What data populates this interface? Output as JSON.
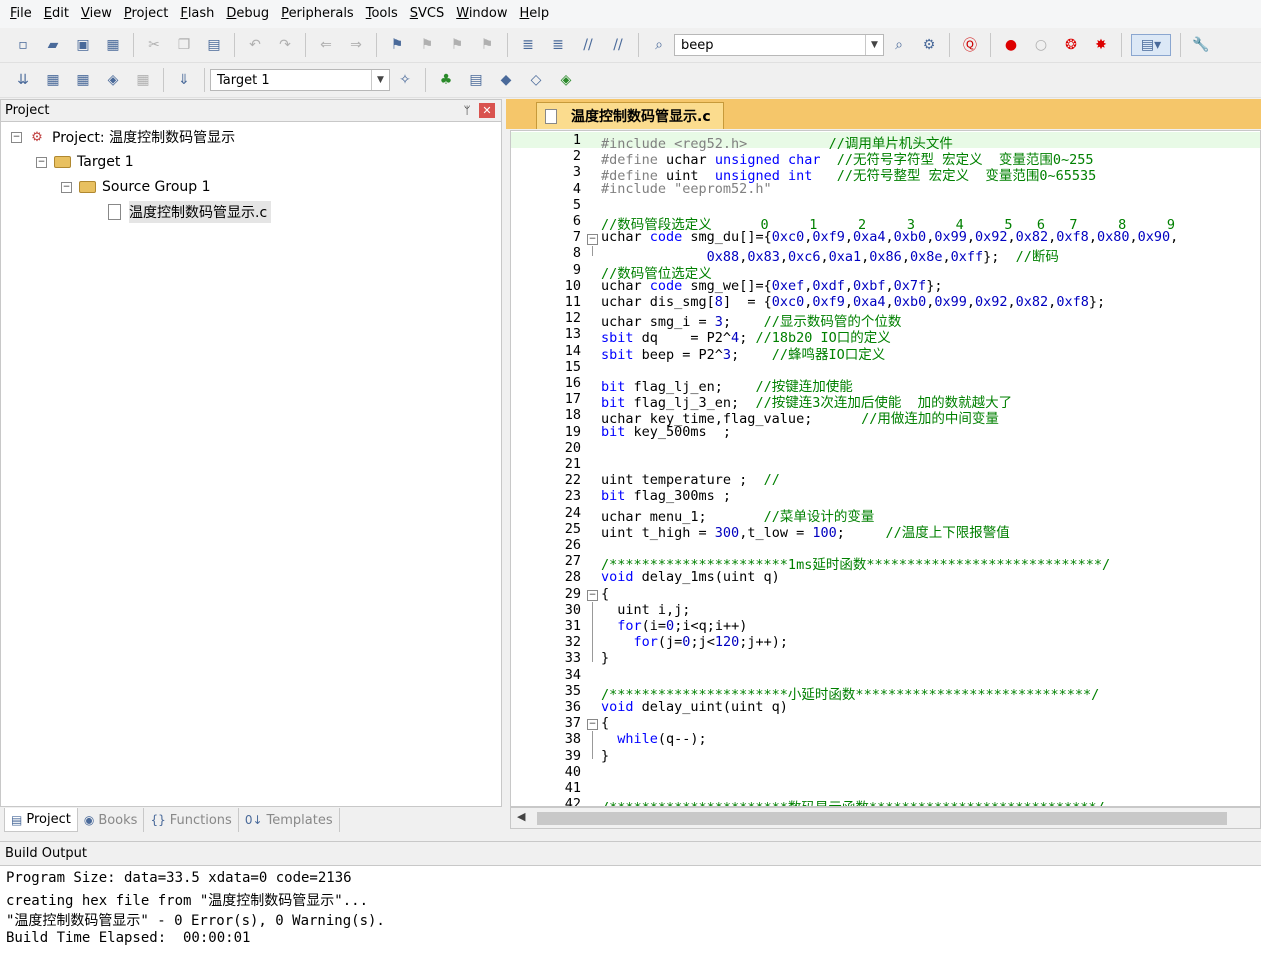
{
  "menu": [
    "File",
    "Edit",
    "View",
    "Project",
    "Flash",
    "Debug",
    "Peripherals",
    "Tools",
    "SVCS",
    "Window",
    "Help"
  ],
  "toolbar": {
    "find_combo_value": "beep",
    "target_combo_value": "Target 1"
  },
  "project_panel": {
    "title": "Project",
    "pin": "ᛘ",
    "close": "✕",
    "project_label": "Project: 温度控制数码管显示",
    "target_label": "Target 1",
    "group_label": "Source Group 1",
    "file_label": "温度控制数码管显示.c",
    "tabs": [
      {
        "icon": "▤",
        "label": "Project"
      },
      {
        "icon": "◉",
        "label": "Books"
      },
      {
        "icon": "{}",
        "label": "Functions"
      },
      {
        "icon": "0↓",
        "label": "Templates"
      }
    ]
  },
  "editor": {
    "tab_label": "温度控制数码管显示.c",
    "line_numbers": [
      "1",
      "2",
      "3",
      "4",
      "5",
      "6",
      "7",
      "8",
      "9",
      "10",
      "11",
      "12",
      "13",
      "14",
      "15",
      "16",
      "17",
      "18",
      "19",
      "20",
      "21",
      "22",
      "23",
      "24",
      "25",
      "26",
      "27",
      "28",
      "29",
      "30",
      "31",
      "32",
      "33",
      "34",
      "35",
      "36",
      "37",
      "38",
      "39",
      "40",
      "41",
      "42"
    ],
    "lines": [
      [
        [
          "pp",
          "#include <reg52.h>          "
        ],
        [
          "cm",
          "//调用单片机头文件"
        ]
      ],
      [
        [
          "pp",
          "#define "
        ],
        [
          "t",
          "uchar "
        ],
        [
          "kw",
          "unsigned char  "
        ],
        [
          "cm",
          "//无符号字符型 宏定义  变量范围0~255"
        ]
      ],
      [
        [
          "pp",
          "#define "
        ],
        [
          "t",
          "uint  "
        ],
        [
          "kw",
          "unsigned int   "
        ],
        [
          "cm",
          "//无符号整型 宏定义  变量范围0~65535"
        ]
      ],
      [
        [
          "pp",
          "#include \"eeprom52.h\""
        ]
      ],
      [
        [
          "t",
          ""
        ]
      ],
      [
        [
          "cm",
          "//数码管段选定义      0     1     2     3     4     5   6   7     8     9"
        ]
      ],
      [
        [
          "t",
          "uchar "
        ],
        [
          "kw",
          "code "
        ],
        [
          "t",
          "smg_du[]={"
        ],
        [
          "num",
          "0xc0"
        ],
        [
          "t",
          ","
        ],
        [
          "num",
          "0xf9"
        ],
        [
          "t",
          ","
        ],
        [
          "num",
          "0xa4"
        ],
        [
          "t",
          ","
        ],
        [
          "num",
          "0xb0"
        ],
        [
          "t",
          ","
        ],
        [
          "num",
          "0x99"
        ],
        [
          "t",
          ","
        ],
        [
          "num",
          "0x92"
        ],
        [
          "t",
          ","
        ],
        [
          "num",
          "0x82"
        ],
        [
          "t",
          ","
        ],
        [
          "num",
          "0xf8"
        ],
        [
          "t",
          ","
        ],
        [
          "num",
          "0x80"
        ],
        [
          "t",
          ","
        ],
        [
          "num",
          "0x90"
        ],
        [
          "t",
          ","
        ]
      ],
      [
        [
          "t",
          "             "
        ],
        [
          "num",
          "0x88"
        ],
        [
          "t",
          ","
        ],
        [
          "num",
          "0x83"
        ],
        [
          "t",
          ","
        ],
        [
          "num",
          "0xc6"
        ],
        [
          "t",
          ","
        ],
        [
          "num",
          "0xa1"
        ],
        [
          "t",
          ","
        ],
        [
          "num",
          "0x86"
        ],
        [
          "t",
          ","
        ],
        [
          "num",
          "0x8e"
        ],
        [
          "t",
          ","
        ],
        [
          "num",
          "0xff"
        ],
        [
          "t",
          "};  "
        ],
        [
          "cm",
          "//断码"
        ]
      ],
      [
        [
          "cm",
          "//数码管位选定义"
        ]
      ],
      [
        [
          "t",
          "uchar "
        ],
        [
          "kw",
          "code "
        ],
        [
          "t",
          "smg_we[]={"
        ],
        [
          "num",
          "0xef"
        ],
        [
          "t",
          ","
        ],
        [
          "num",
          "0xdf"
        ],
        [
          "t",
          ","
        ],
        [
          "num",
          "0xbf"
        ],
        [
          "t",
          ","
        ],
        [
          "num",
          "0x7f"
        ],
        [
          "t",
          "};"
        ]
      ],
      [
        [
          "t",
          "uchar dis_smg["
        ],
        [
          "num",
          "8"
        ],
        [
          "t",
          "]  = {"
        ],
        [
          "num",
          "0xc0"
        ],
        [
          "t",
          ","
        ],
        [
          "num",
          "0xf9"
        ],
        [
          "t",
          ","
        ],
        [
          "num",
          "0xa4"
        ],
        [
          "t",
          ","
        ],
        [
          "num",
          "0xb0"
        ],
        [
          "t",
          ","
        ],
        [
          "num",
          "0x99"
        ],
        [
          "t",
          ","
        ],
        [
          "num",
          "0x92"
        ],
        [
          "t",
          ","
        ],
        [
          "num",
          "0x82"
        ],
        [
          "t",
          ","
        ],
        [
          "num",
          "0xf8"
        ],
        [
          "t",
          "};"
        ]
      ],
      [
        [
          "t",
          "uchar smg_i = "
        ],
        [
          "num",
          "3"
        ],
        [
          "t",
          ";    "
        ],
        [
          "cm",
          "//显示数码管的个位数"
        ]
      ],
      [
        [
          "kw",
          "sbit "
        ],
        [
          "t",
          "dq    = P2^"
        ],
        [
          "num",
          "4"
        ],
        [
          "t",
          "; "
        ],
        [
          "cm",
          "//18b20 IO口的定义"
        ]
      ],
      [
        [
          "kw",
          "sbit "
        ],
        [
          "t",
          "beep = P2^"
        ],
        [
          "num",
          "3"
        ],
        [
          "t",
          ";    "
        ],
        [
          "cm",
          "//蜂鸣器IO口定义"
        ]
      ],
      [
        [
          "t",
          ""
        ]
      ],
      [
        [
          "kw",
          "bit "
        ],
        [
          "t",
          "flag_lj_en;    "
        ],
        [
          "cm",
          "//按键连加使能"
        ]
      ],
      [
        [
          "kw",
          "bit "
        ],
        [
          "t",
          "flag_lj_3_en;  "
        ],
        [
          "cm",
          "//按键连3次连加后使能  加的数就越大了"
        ]
      ],
      [
        [
          "t",
          "uchar key_time,flag_value;      "
        ],
        [
          "cm",
          "//用做连加的中间变量"
        ]
      ],
      [
        [
          "kw",
          "bit "
        ],
        [
          "t",
          "key_500ms  ;"
        ]
      ],
      [
        [
          "t",
          ""
        ]
      ],
      [
        [
          "t",
          ""
        ]
      ],
      [
        [
          "t",
          "uint temperature ;  "
        ],
        [
          "cm",
          "//"
        ]
      ],
      [
        [
          "kw",
          "bit "
        ],
        [
          "t",
          "flag_300ms ;"
        ]
      ],
      [
        [
          "t",
          "uchar menu_1;       "
        ],
        [
          "cm",
          "//菜单设计的变量"
        ]
      ],
      [
        [
          "t",
          "uint t_high = "
        ],
        [
          "num",
          "300"
        ],
        [
          "t",
          ",t_low = "
        ],
        [
          "num",
          "100"
        ],
        [
          "t",
          ";     "
        ],
        [
          "cm",
          "//温度上下限报警值"
        ]
      ],
      [
        [
          "t",
          ""
        ]
      ],
      [
        [
          "cm",
          "/**********************1ms延时函数*****************************/"
        ]
      ],
      [
        [
          "kw",
          "void "
        ],
        [
          "t",
          "delay_1ms(uint q)"
        ]
      ],
      [
        [
          "t",
          "{"
        ]
      ],
      [
        [
          "t",
          "  uint i,j;"
        ]
      ],
      [
        [
          "t",
          "  "
        ],
        [
          "kw",
          "for"
        ],
        [
          "t",
          "(i="
        ],
        [
          "num",
          "0"
        ],
        [
          "t",
          ";i<q;i++)"
        ]
      ],
      [
        [
          "t",
          "    "
        ],
        [
          "kw",
          "for"
        ],
        [
          "t",
          "(j="
        ],
        [
          "num",
          "0"
        ],
        [
          "t",
          ";j<"
        ],
        [
          "num",
          "120"
        ],
        [
          "t",
          ";j++);"
        ]
      ],
      [
        [
          "t",
          "}"
        ]
      ],
      [
        [
          "t",
          ""
        ]
      ],
      [
        [
          "cm",
          "/**********************小延时函数*****************************/"
        ]
      ],
      [
        [
          "kw",
          "void "
        ],
        [
          "t",
          "delay_uint(uint q)"
        ]
      ],
      [
        [
          "t",
          "{"
        ]
      ],
      [
        [
          "t",
          "  "
        ],
        [
          "kw",
          "while"
        ],
        [
          "t",
          "(q--);"
        ]
      ],
      [
        [
          "t",
          "}"
        ]
      ],
      [
        [
          "t",
          ""
        ]
      ],
      [
        [
          "t",
          ""
        ]
      ],
      [
        [
          "cm",
          "/**********************数码显示函数****************************/"
        ]
      ]
    ]
  },
  "build_output": {
    "title": "Build Output",
    "lines": [
      "Program Size: data=33.5 xdata=0 code=2136",
      "creating hex file from \"温度控制数码管显示\"...",
      "\"温度控制数码管显示\" - 0 Error(s), 0 Warning(s).",
      "Build Time Elapsed:  00:00:01"
    ]
  }
}
